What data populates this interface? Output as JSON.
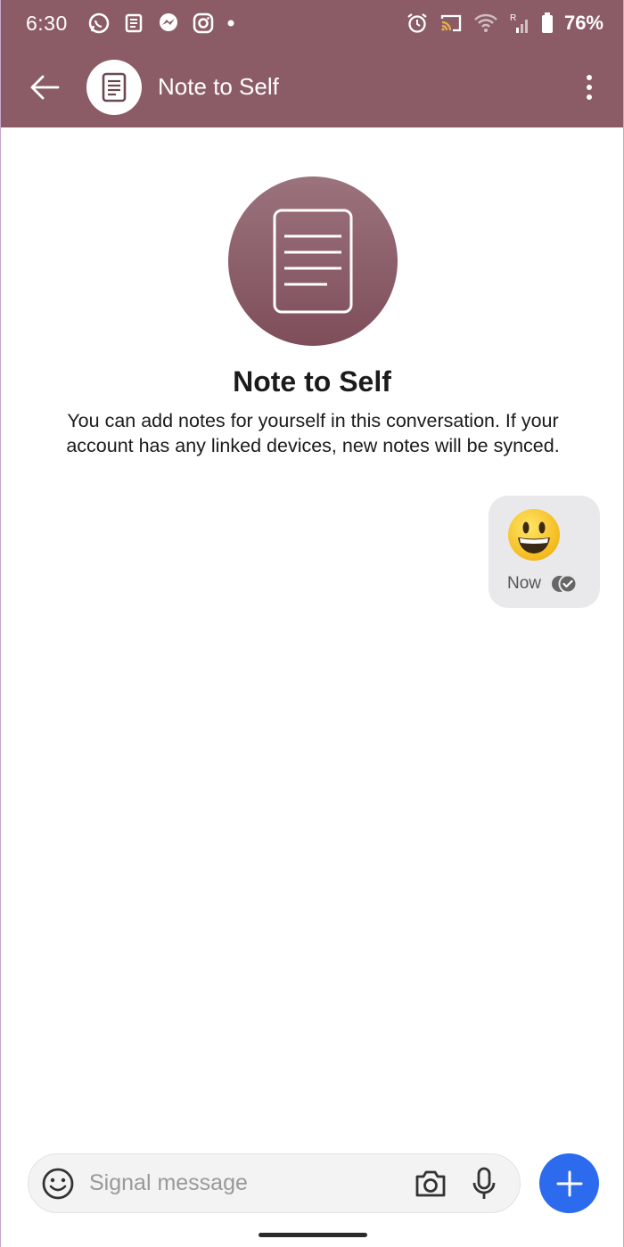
{
  "status_bar": {
    "time": "6:30",
    "battery": "76%",
    "notification_icons": [
      "whatsapp-icon",
      "news-icon",
      "messenger-icon",
      "instagram-icon",
      "dot-icon"
    ],
    "system_icons": [
      "alarm-icon",
      "cast-icon",
      "wifi-icon",
      "signal-icon",
      "battery-icon"
    ]
  },
  "toolbar": {
    "title": "Note to Self",
    "back_icon": "arrow-left-icon",
    "overflow_icon": "more-vertical-icon"
  },
  "intro": {
    "title": "Note to Self",
    "description": "You can add notes for yourself in this conversation. If your account has any linked devices, new notes will be synced."
  },
  "messages": [
    {
      "content": "😃",
      "time": "Now",
      "status_icon": "delivered-check-icon"
    }
  ],
  "composer": {
    "placeholder": "Signal message",
    "value": ""
  },
  "colors": {
    "app_bar": "#8b5c66",
    "avatar": "#8a5e68",
    "bubble": "#e9e9eb",
    "fab": "#2c6bed"
  }
}
